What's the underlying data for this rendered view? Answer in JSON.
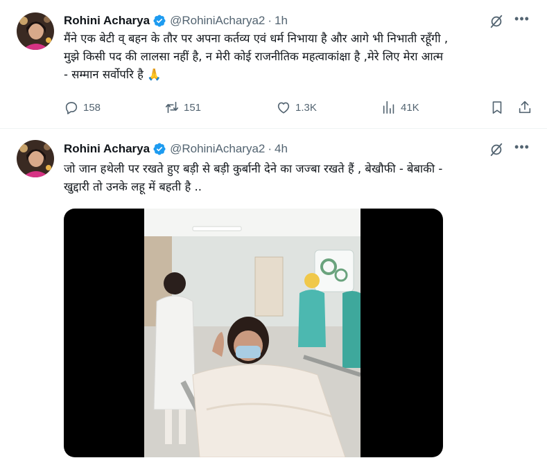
{
  "tweets": [
    {
      "name": "Rohini Acharya",
      "handle": "@RohiniAcharya2",
      "separator": "·",
      "time": "1h",
      "text_lines": [
        "मैंने एक बेटी व् बहन के तौर पर अपना कर्तव्य एवं धर्म निभाया है और आगे भी निभाती रहूँगी ,",
        "मुझे किसी पद की लालसा नहीं है, न मेरी कोई राजनीतिक महत्वाकांक्षा है ,मेरे लिए मेरा आत्म",
        "- सम्मान सर्वोपरि है 🙏"
      ],
      "stats": {
        "replies": "158",
        "retweets": "151",
        "likes": "1.3K",
        "views": "41K"
      }
    },
    {
      "name": "Rohini Acharya",
      "handle": "@RohiniAcharya2",
      "separator": "·",
      "time": "4h",
      "text_lines": [
        "जो जान हथेली पर रखते हुए बड़ी से बड़ी कुर्बानी देने का जज्बा रखते हैं , बेखौफी - बेबाकी -",
        "खुद्दारी तो उनके लहू में बहती है .."
      ]
    }
  ],
  "colors": {
    "text": "#0f1419",
    "secondary": "#536471",
    "verified": "#1d9bf0",
    "divider": "#eff3f4"
  },
  "icons": [
    "verified-badge-icon",
    "grok-icon",
    "more-icon",
    "reply-icon",
    "retweet-icon",
    "like-icon",
    "views-icon",
    "bookmark-icon",
    "share-icon"
  ]
}
